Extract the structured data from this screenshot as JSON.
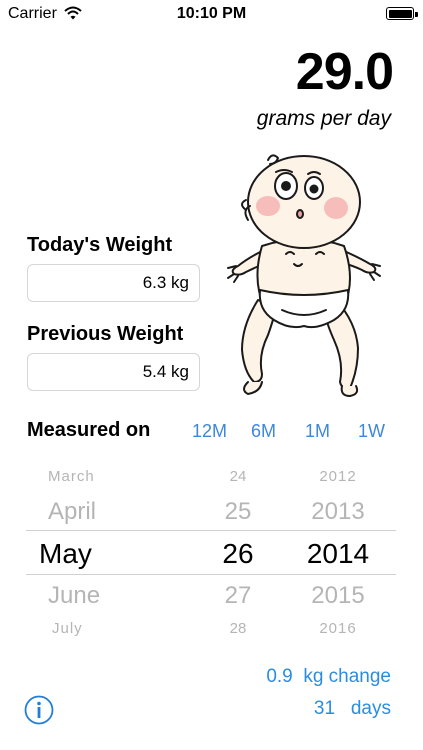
{
  "status": {
    "carrier": "Carrier",
    "time": "10:10 PM"
  },
  "rate": {
    "value": "29.0",
    "unit": "grams per day"
  },
  "today": {
    "label": "Today's Weight",
    "value": "6.3 kg"
  },
  "previous": {
    "label": "Previous Weight",
    "value": "5.4 kg"
  },
  "measured": {
    "label": "Measured on",
    "ranges": [
      "12M",
      "6M",
      "1M",
      "1W"
    ]
  },
  "picker": {
    "months": [
      "March",
      "April",
      "May",
      "June",
      "July"
    ],
    "days": [
      "24",
      "25",
      "26",
      "27",
      "28"
    ],
    "years": [
      "2012",
      "2013",
      "2014",
      "2015",
      "2016"
    ],
    "selected": {
      "month": "May",
      "day": "26",
      "year": "2014"
    }
  },
  "summary": {
    "change_value": "0.9",
    "change_label": "kg change",
    "days_value": "31",
    "days_label": "days"
  },
  "colors": {
    "accent": "#3d88dc",
    "summary": "#2a8de1",
    "info_icon": "#1f7fd6"
  },
  "icons": {
    "wifi": "wifi-icon",
    "battery": "battery-icon",
    "info": "info-icon",
    "illustration": "baby-illustration"
  }
}
